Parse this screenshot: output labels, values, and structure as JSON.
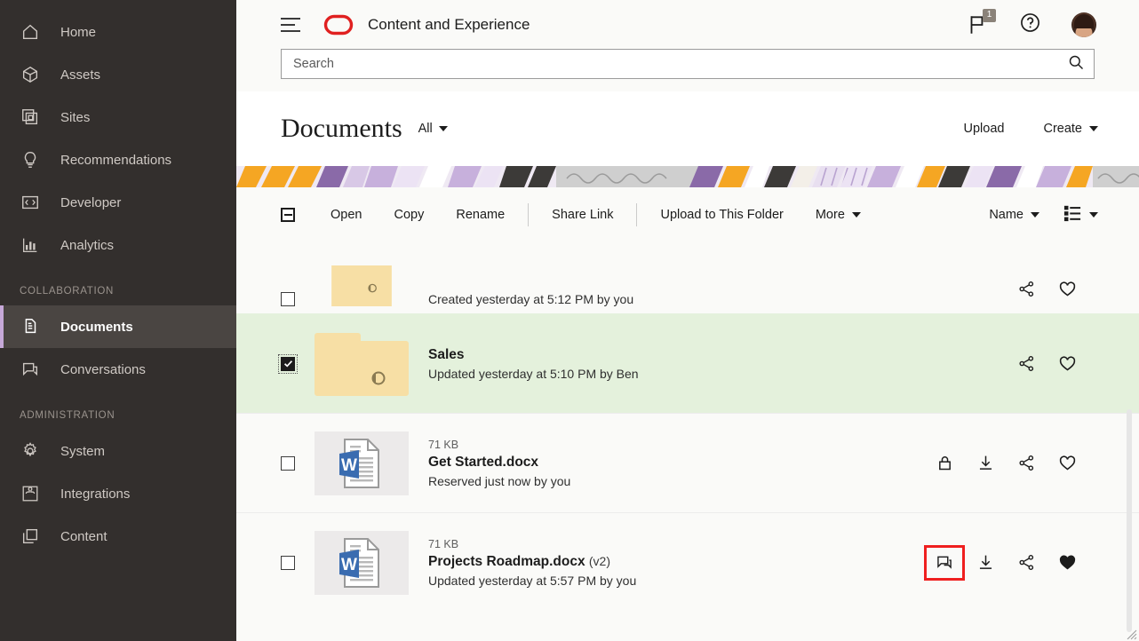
{
  "sidebar": {
    "items": [
      {
        "label": "Home",
        "icon": "home-icon",
        "active": false
      },
      {
        "label": "Assets",
        "icon": "cube-icon",
        "active": false
      },
      {
        "label": "Sites",
        "icon": "sites-icon",
        "active": false
      },
      {
        "label": "Recommendations",
        "icon": "bulb-icon",
        "active": false
      },
      {
        "label": "Developer",
        "icon": "code-icon",
        "active": false
      },
      {
        "label": "Analytics",
        "icon": "chart-icon",
        "active": false
      }
    ],
    "section_collaboration": "COLLABORATION",
    "collaboration_items": [
      {
        "label": "Documents",
        "icon": "documents-icon",
        "active": true
      },
      {
        "label": "Conversations",
        "icon": "conversations-icon",
        "active": false
      }
    ],
    "section_administration": "ADMINISTRATION",
    "administration_items": [
      {
        "label": "System",
        "icon": "gear-icon",
        "active": false
      },
      {
        "label": "Integrations",
        "icon": "integrations-icon",
        "active": false
      },
      {
        "label": "Content",
        "icon": "content-icon",
        "active": false
      }
    ],
    "accent_color": "#c6a8d8",
    "background_color": "#332f2d"
  },
  "topbar": {
    "app_title": "Content and Experience",
    "menu_icon": "hamburger-icon",
    "logo_icon": "oracle-logo-icon",
    "logo_color": "#e02020",
    "flag_icon": "flag-icon",
    "flag_badge": "1",
    "help_icon": "help-icon",
    "avatar_icon": "user-avatar"
  },
  "search": {
    "placeholder": "Search",
    "value": "",
    "icon": "search-icon"
  },
  "page": {
    "title": "Documents",
    "filter_label": "All",
    "upload_label": "Upload",
    "create_label": "Create"
  },
  "toolbar": {
    "select_all_state": "indeterminate",
    "items": [
      {
        "label": "Open"
      },
      {
        "label": "Copy"
      },
      {
        "label": "Rename"
      },
      {
        "label": "Share Link"
      },
      {
        "label": "Upload to This Folder"
      },
      {
        "label": "More",
        "has_caret": true
      }
    ],
    "sort_label": "Name",
    "view_icon": "list-view-icon"
  },
  "list": {
    "rows": [
      {
        "type": "folder",
        "name": "",
        "size": "",
        "subtitle": "Created yesterday at 5:12 PM by you",
        "checked": false,
        "selected": false,
        "partial": true,
        "favorited": false,
        "actions": [
          "share-icon",
          "favorite-icon"
        ]
      },
      {
        "type": "folder",
        "name": "Sales",
        "size": "",
        "subtitle": "Updated yesterday at 5:10 PM by Ben",
        "checked": true,
        "selected": true,
        "partial": false,
        "favorited": false,
        "actions": [
          "share-icon",
          "favorite-icon"
        ]
      },
      {
        "type": "docx",
        "name": "Get Started.docx",
        "version": "",
        "size": "71 KB",
        "subtitle": "Reserved just now by you",
        "checked": false,
        "selected": false,
        "partial": false,
        "favorited": false,
        "actions": [
          "lock-icon",
          "download-icon",
          "share-icon",
          "favorite-icon"
        ]
      },
      {
        "type": "docx",
        "name": "Projects Roadmap.docx",
        "version": "(v2)",
        "size": "71 KB",
        "subtitle": "Updated yesterday at 5:57 PM by you",
        "checked": false,
        "selected": false,
        "partial": false,
        "favorited": true,
        "highlight_action_index": 0,
        "actions": [
          "conversation-icon",
          "download-icon",
          "share-icon",
          "favorite-icon"
        ]
      }
    ],
    "selected_row_color": "#e4f1dc",
    "highlight_box_color": "#ef1f1f"
  }
}
